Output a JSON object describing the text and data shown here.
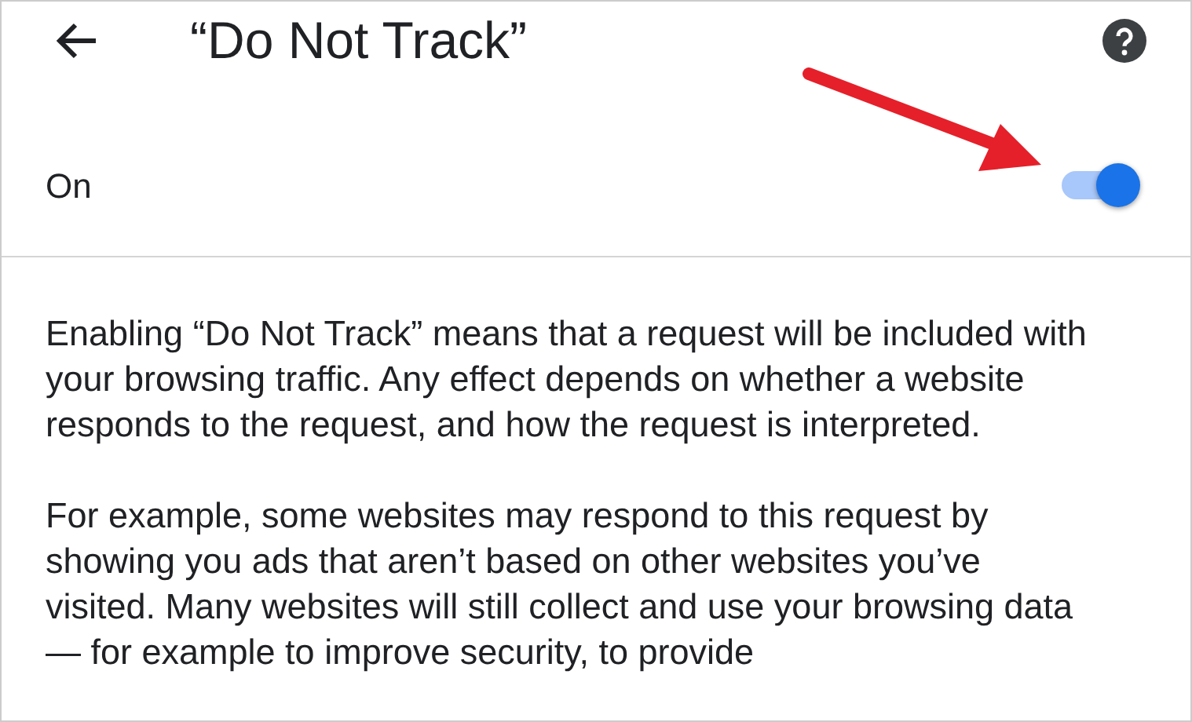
{
  "header": {
    "title": "“Do Not Track”"
  },
  "setting": {
    "label": "On",
    "on": true
  },
  "paragraphs": [
    "Enabling “Do Not Track” means that a request will be included with your browsing traffic. Any effect depends on whether a website responds to the request, and how the request is interpreted.",
    "For example, some websites may respond to this request by showing you ads that aren’t based on other websites you’ve visited. Many websites will still collect and use your browsing data — for example to improve security, to provide"
  ]
}
